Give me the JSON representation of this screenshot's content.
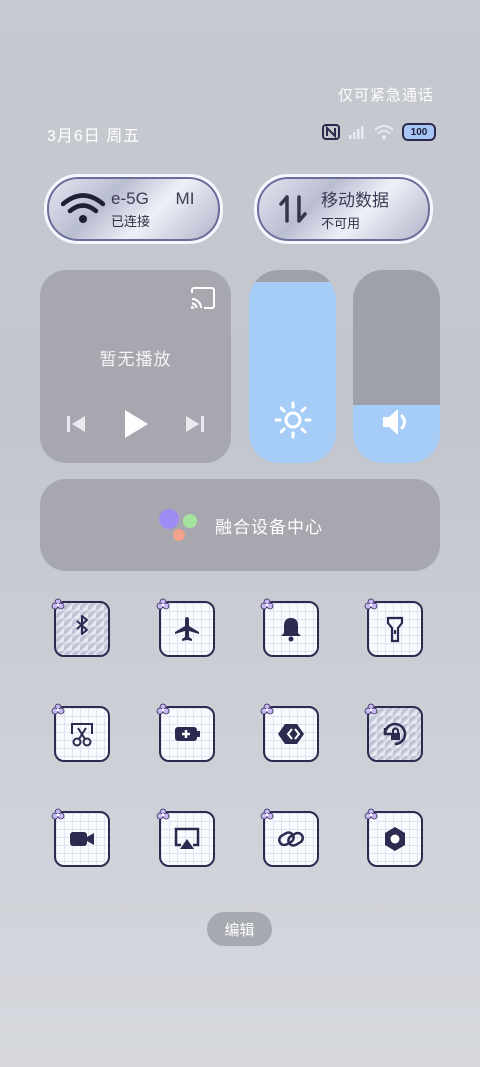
{
  "header": {
    "emergency_text": "仅可紧急通话",
    "date_text": "3月6日 周五",
    "battery_text": "100",
    "status_icons": [
      "nfc-icon",
      "signal-icon",
      "wifi-icon",
      "battery-icon"
    ]
  },
  "network": {
    "wifi": {
      "name_text": "e-5G",
      "name_extra": "MI",
      "status_text": "已连接"
    },
    "mobile": {
      "name_text": "移动数据",
      "status_text": "不可用"
    }
  },
  "media": {
    "empty_text": "暂无播放"
  },
  "sliders": {
    "brightness_level": 0.94,
    "volume_level": 0.3
  },
  "fusion": {
    "label": "融合设备中心"
  },
  "tiles": [
    {
      "icon": "bluetooth-icon"
    },
    {
      "icon": "airplane-icon"
    },
    {
      "icon": "bell-icon"
    },
    {
      "icon": "flashlight-icon"
    },
    {
      "icon": "screenshot-icon"
    },
    {
      "icon": "battery-saver-icon"
    },
    {
      "icon": "shortcut-icon"
    },
    {
      "icon": "rotation-lock-icon"
    },
    {
      "icon": "video-icon"
    },
    {
      "icon": "screen-cast-icon"
    },
    {
      "icon": "link-icon"
    },
    {
      "icon": "settings-icon"
    }
  ],
  "footer": {
    "edit_label": "编辑"
  },
  "colors": {
    "accent": "#a6cdf8",
    "card": "#a6a7af",
    "tile_border": "#2c2b4f"
  }
}
